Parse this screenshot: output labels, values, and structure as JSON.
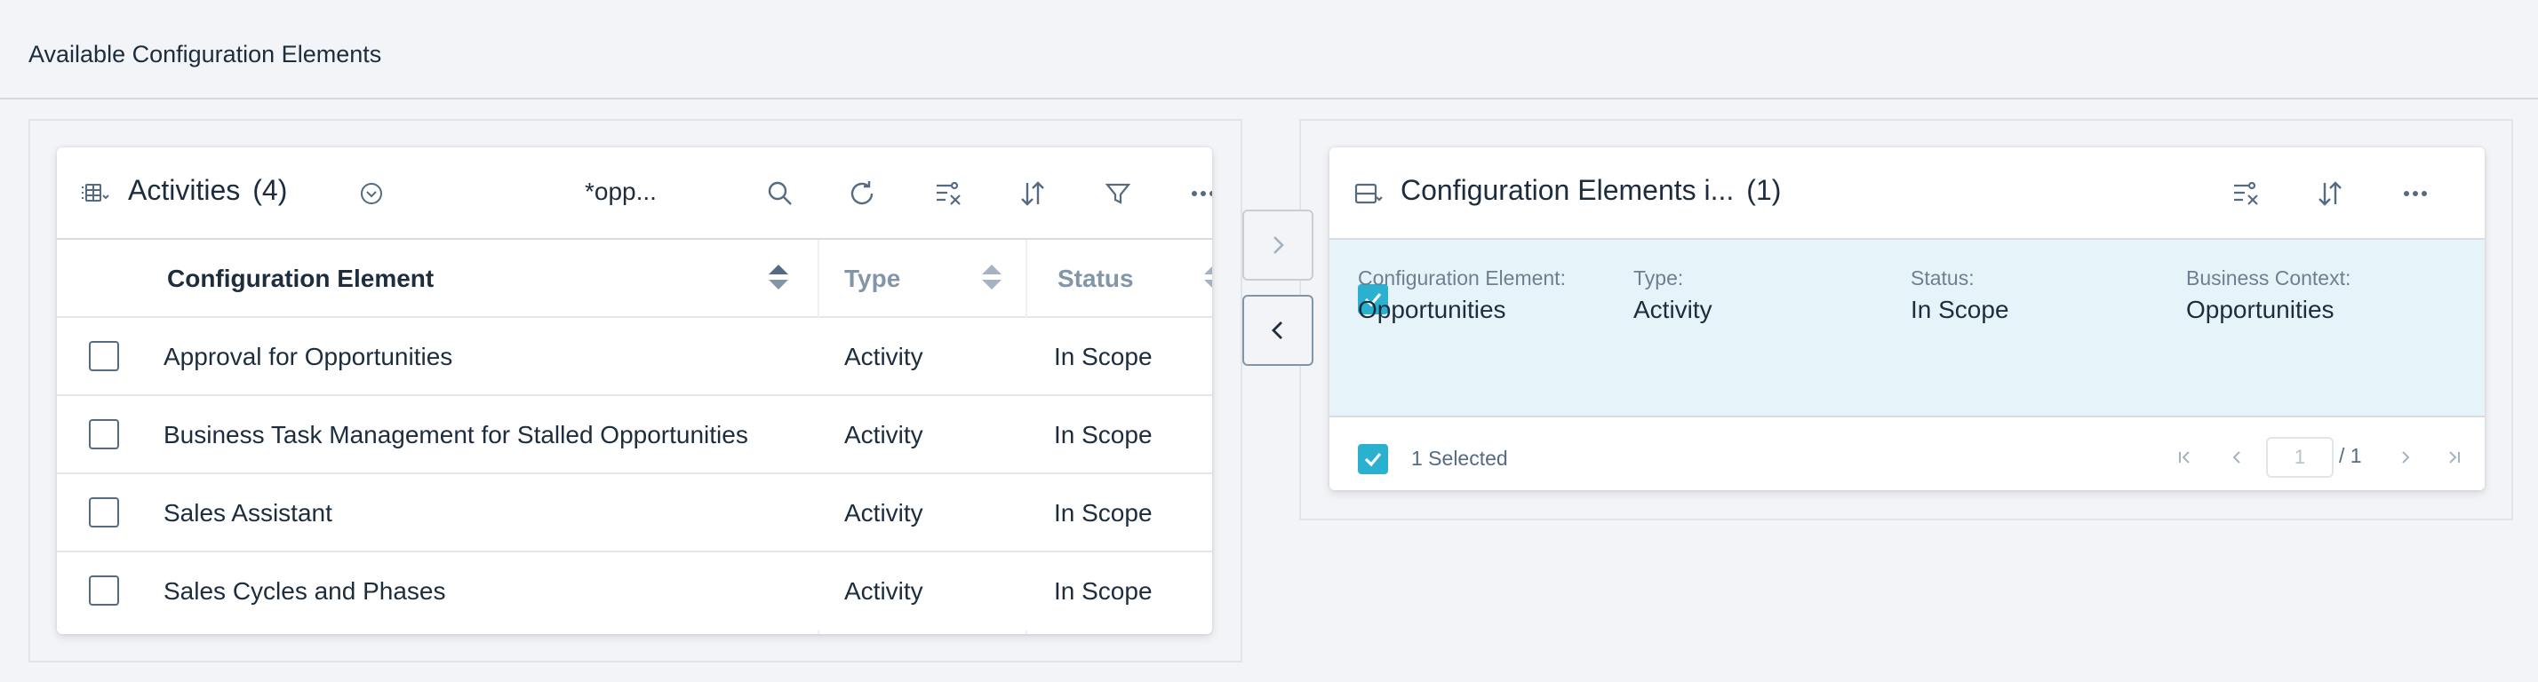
{
  "page": {
    "title": "Available Configuration Elements"
  },
  "left": {
    "title": "Activities",
    "count": "(4)",
    "search_term": "*opp...",
    "columns": [
      "Configuration Element",
      "Type",
      "Status"
    ],
    "rows": [
      {
        "element": "Approval for Opportunities",
        "type": "Activity",
        "status": "In Scope"
      },
      {
        "element": "Business Task Management for Stalled Opportunities",
        "type": "Activity",
        "status": "In Scope"
      },
      {
        "element": "Sales Assistant",
        "type": "Activity",
        "status": "In Scope"
      },
      {
        "element": "Sales Cycles and Phases",
        "type": "Activity",
        "status": "In Scope"
      }
    ]
  },
  "right": {
    "title": "Configuration Elements i...",
    "count": "(1)",
    "selected_item": {
      "fields": [
        {
          "label": "Configuration Element:",
          "value": "Opportunities"
        },
        {
          "label": "Type:",
          "value": "Activity"
        },
        {
          "label": "Status:",
          "value": "In Scope"
        },
        {
          "label": "Business Context:",
          "value": "Opportunities"
        }
      ]
    },
    "footer": {
      "selected_text": "1 Selected",
      "page_value": "1",
      "page_total": "/ 1"
    }
  },
  "colors": {
    "accent": "#2ab1cf",
    "selected_bg": "#e6f4f9",
    "icon": "#556b82"
  }
}
